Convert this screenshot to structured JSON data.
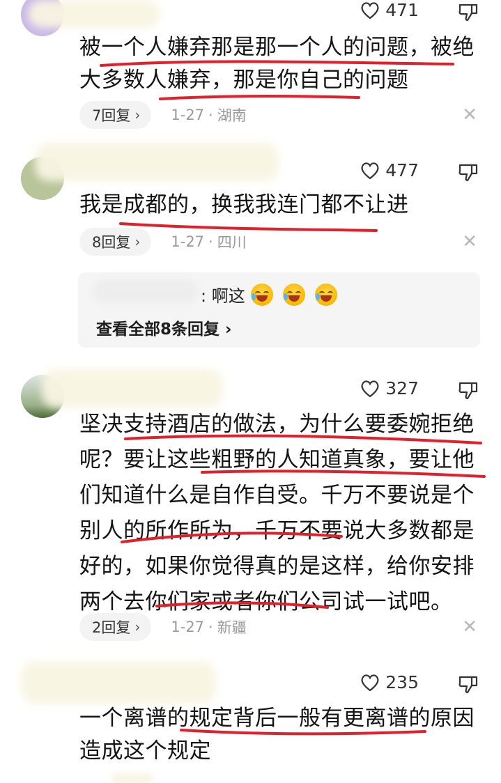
{
  "comments": [
    {
      "likes": "471",
      "text": "被一个人嫌弃那是那一个人的问题，被绝大多数人嫌弃，那是你自己的问题",
      "replies": "7回复",
      "date": "1-27",
      "location": "湖南"
    },
    {
      "likes": "477",
      "text": "我是成都的，换我我连门都不让进",
      "replies": "8回复",
      "date": "1-27",
      "location": "四川",
      "sub_reply": {
        "text": ": 啊这",
        "view_all": "查看全部8条回复"
      }
    },
    {
      "likes": "327",
      "text": "坚决支持酒店的做法，为什么要委婉拒绝呢？要让这些粗野的人知道真象，要让他们知道什么是自作自受。千万不要说是个别人的所作所为，千万不要说大多数都是好的，如果你觉得真的是这样，给你安排两个去你们家或者你们公司试一试吧。",
      "replies": "2回复",
      "date": "1-27",
      "location": "新疆"
    },
    {
      "likes": "235",
      "text": "一个离谱的规定背后一般有更离谱的原因造成这个规定"
    }
  ],
  "icons": {
    "like": "heart-icon",
    "dislike": "thumbs-down-icon",
    "close": "close-icon",
    "chevron": "chevron-right-icon"
  },
  "colors": {
    "underline": "#e0202a",
    "meta": "#9a9a9a",
    "pill_bg": "#f3f3f3"
  }
}
